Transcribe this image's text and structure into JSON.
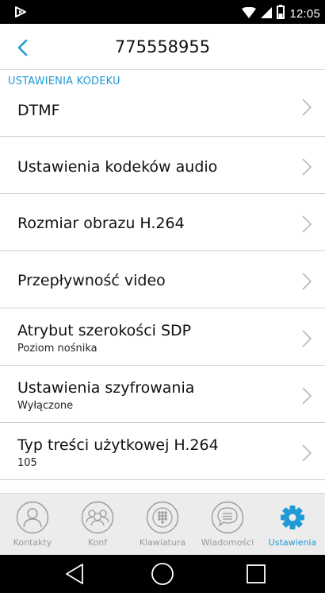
{
  "status_bar": {
    "time": "12:05",
    "icons": [
      "app-notification-icon",
      "wifi-icon",
      "signal-icon",
      "battery-icon"
    ]
  },
  "header": {
    "title": "775558955",
    "back_icon": "chevron-left-icon"
  },
  "section": {
    "label": "USTAWIENIA KODEKU"
  },
  "settings": {
    "items": [
      {
        "label": "DTMF",
        "sub": ""
      },
      {
        "label": "Ustawienia kodeków audio",
        "sub": ""
      },
      {
        "label": "Rozmiar obrazu H.264",
        "sub": ""
      },
      {
        "label": "Przepływność video",
        "sub": ""
      },
      {
        "label": "Atrybut szerokości SDP",
        "sub": "Poziom nośnika"
      },
      {
        "label": "Ustawienia szyfrowania",
        "sub": "Wyłączone"
      },
      {
        "label": "Typ treści użytkowej H.264",
        "sub": "105"
      }
    ]
  },
  "tabs": [
    {
      "label": "Kontakty",
      "icon": "contact-icon"
    },
    {
      "label": "Konf",
      "icon": "conference-icon"
    },
    {
      "label": "Klawiatura",
      "icon": "keypad-icon"
    },
    {
      "label": "Wiadomości",
      "icon": "message-icon"
    },
    {
      "label": "Ustawienia",
      "icon": "gear-icon",
      "active": true
    }
  ],
  "colors": {
    "accent": "#1e9ad6",
    "tab_inactive": "#9a9a9a",
    "chevron": "#b8b8b8"
  }
}
